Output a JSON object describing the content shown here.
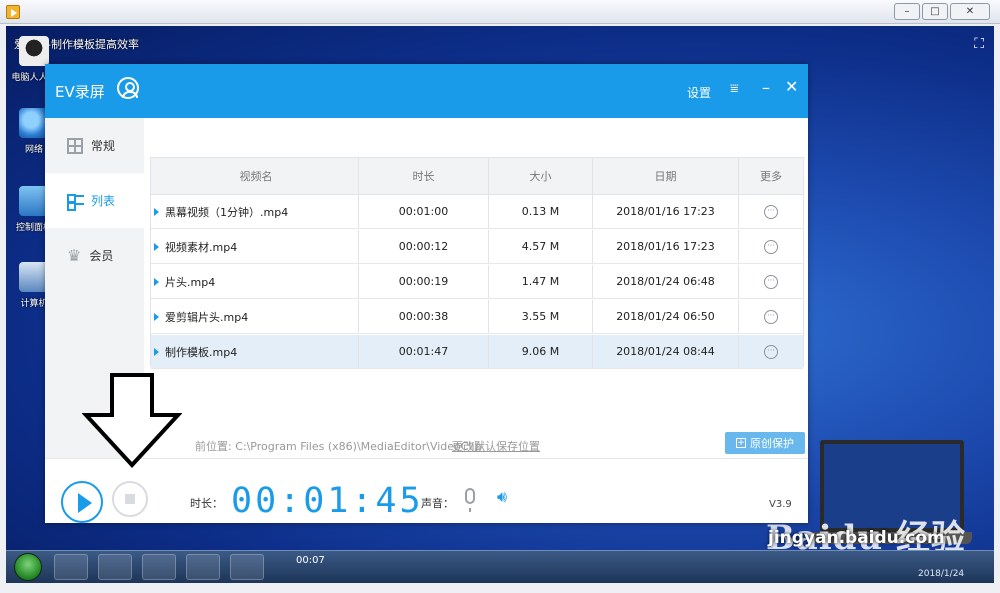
{
  "video": {
    "title": "爱剪辑-制作模板提高效率",
    "desktop_icons": [
      {
        "label": "电脑人人有",
        "icon": "user-logo-icon"
      },
      {
        "label": "网络",
        "icon": "network-icon"
      },
      {
        "label": "控制面板",
        "icon": "control-panel-icon"
      },
      {
        "label": "计算机",
        "icon": "computer-icon"
      }
    ],
    "taskbar_time": "00:07",
    "taskbar_date": "2018/1/24"
  },
  "ev": {
    "title": "EV录屏",
    "settings_label": "设置",
    "sidebar": [
      {
        "label": "常规",
        "icon": "grid-icon",
        "active": false
      },
      {
        "label": "列表",
        "icon": "list-icon",
        "active": true
      },
      {
        "label": "会员",
        "icon": "crown-icon",
        "active": false
      }
    ],
    "table": {
      "columns": [
        "视频名",
        "时长",
        "大小",
        "日期",
        "更多"
      ],
      "rows": [
        {
          "name": "黑幕视频（1分钟）.mp4",
          "duration": "00:01:00",
          "size": "0.13 M",
          "date": "2018/01/16 17:23"
        },
        {
          "name": "视频素材.mp4",
          "duration": "00:00:12",
          "size": "4.57 M",
          "date": "2018/01/16 17:23"
        },
        {
          "name": "片头.mp4",
          "duration": "00:00:19",
          "size": "1.47 M",
          "date": "2018/01/24 06:48"
        },
        {
          "name": "爱剪辑片头.mp4",
          "duration": "00:00:38",
          "size": "3.55 M",
          "date": "2018/01/24 06:50"
        },
        {
          "name": "制作模板.mp4",
          "duration": "00:01:47",
          "size": "9.06 M",
          "date": "2018/01/24 08:44"
        }
      ],
      "selected_row": 4
    },
    "save_path_label": "前位置:",
    "save_path": "C:\\Program Files (x86)\\MediaEditor\\VideoClip",
    "change_path_link": "更改默认保存位置",
    "protect_button": "原创保护",
    "duration_label": "时长：",
    "timer": "00:01:45",
    "sound_label": "声音：",
    "version": "V3.9"
  },
  "watermark": {
    "brand": "Baidu 经验",
    "url": "jingyan.baidu.com"
  },
  "colors": {
    "accent": "#1a9bea",
    "header": "#1a9bea",
    "selected_row": "#e3eef8"
  }
}
